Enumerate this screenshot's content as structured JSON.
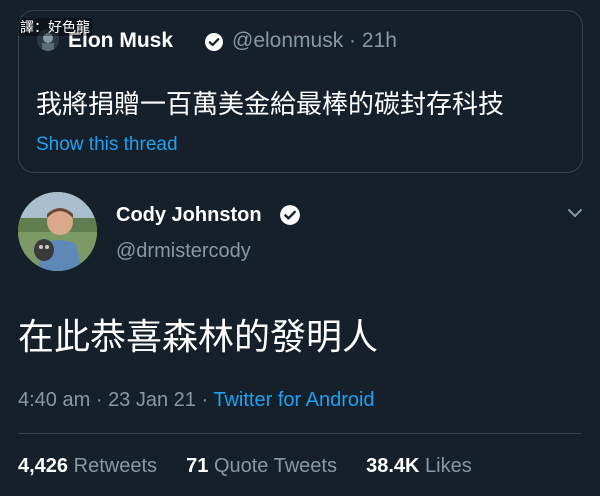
{
  "watermark": "譯：好色龍",
  "quoted_tweet": {
    "author_name": "Elon Musk",
    "author_handle": "@elonmusk",
    "separator": "·",
    "time": "21h",
    "text": "我將捐贈一百萬美金給最棒的碳封存科技",
    "show_thread": "Show this thread"
  },
  "tweet": {
    "author_name": "Cody Johnston",
    "author_handle": "@drmistercody",
    "text": "在此恭喜森林的發明人",
    "time": "4:40 am",
    "sep1": "·",
    "date": "23 Jan 21",
    "sep2": "·",
    "source": "Twitter for Android"
  },
  "stats": {
    "retweets_count": "4,426",
    "retweets_label": "Retweets",
    "quotes_count": "71",
    "quotes_label": "Quote Tweets",
    "likes_count": "38.4K",
    "likes_label": "Likes"
  },
  "colors": {
    "background": "#15202b",
    "accent": "#1da1f2",
    "muted": "#8899a6",
    "border": "#38444d"
  },
  "icons": {
    "verified": "verified-badge-icon",
    "caret": "chevron-down-icon"
  }
}
